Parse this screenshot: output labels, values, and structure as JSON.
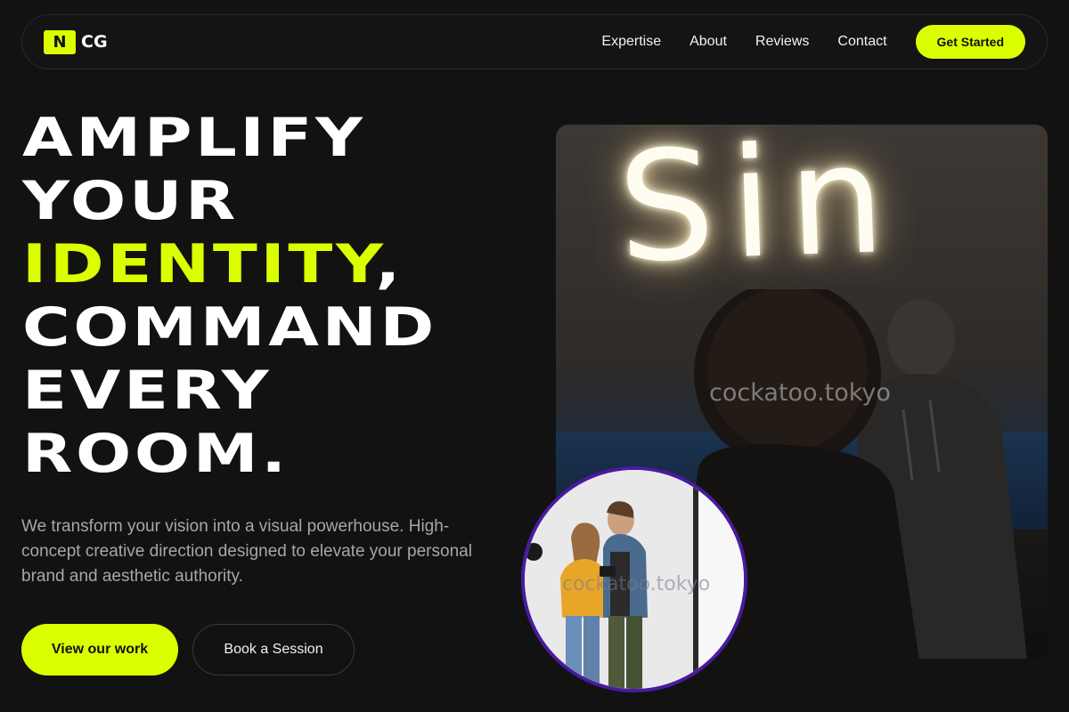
{
  "brand": {
    "logo_letter": "N",
    "logo_text": "CG",
    "accent_color": "#dcff00"
  },
  "nav": {
    "links": [
      "Expertise",
      "About",
      "Reviews",
      "Contact"
    ],
    "cta_label": "Get Started"
  },
  "hero": {
    "headline_lines": [
      "AMPLIFY",
      "YOUR",
      "IDENTITY",
      ",",
      "COMMAND",
      "EVERY",
      "ROOM."
    ],
    "subtext": "We transform your vision into a visual powerhouse. High-concept creative direction designed to elevate your personal brand and aesthetic authority.",
    "primary_button": "View our work",
    "secondary_button": "Book a Session",
    "image_watermark": "cockatoo.tokyo",
    "image_neon_text": "Sin",
    "inset_watermark": "cockatoo.tokyo"
  }
}
